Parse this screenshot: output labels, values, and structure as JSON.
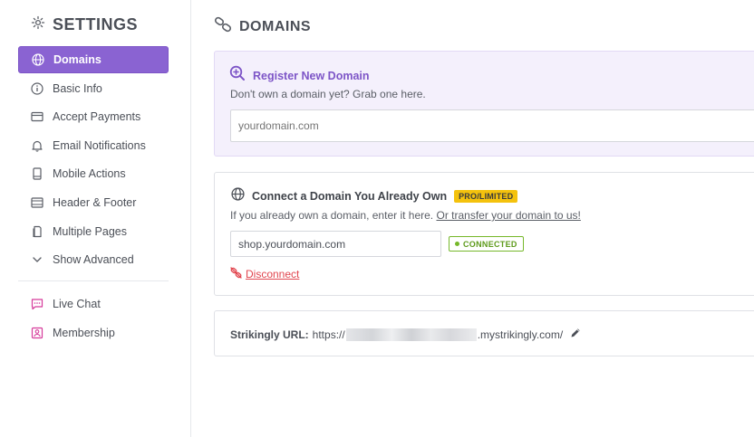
{
  "sidebar": {
    "title": "SETTINGS",
    "items": [
      {
        "label": "Domains",
        "icon": "globe-icon",
        "active": true
      },
      {
        "label": "Basic Info",
        "icon": "info-icon"
      },
      {
        "label": "Accept Payments",
        "icon": "card-icon"
      },
      {
        "label": "Email Notifications",
        "icon": "bell-icon"
      },
      {
        "label": "Mobile Actions",
        "icon": "phone-icon"
      },
      {
        "label": "Header & Footer",
        "icon": "layout-icon"
      },
      {
        "label": "Multiple Pages",
        "icon": "pages-icon"
      },
      {
        "label": "Show Advanced",
        "icon": "chevron-down-icon"
      }
    ],
    "extras": [
      {
        "label": "Live Chat",
        "icon": "chat-icon"
      },
      {
        "label": "Membership",
        "icon": "member-icon"
      }
    ]
  },
  "main": {
    "title": "DOMAINS",
    "register": {
      "title": "Register New Domain",
      "subtitle": "Don't own a domain yet? Grab one here.",
      "placeholder": "yourdomain.com"
    },
    "connect": {
      "title": "Connect a Domain You Already Own",
      "badge": "PRO/LIMITED",
      "subtitle": "If you already own a domain, enter it here.",
      "transfer_link": "Or transfer your domain to us!",
      "value": "shop.yourdomain.com",
      "status": "CONNECTED",
      "disconnect": "Disconnect"
    },
    "url": {
      "label": "Strikingly URL:",
      "prefix": "https://",
      "suffix": ".mystrikingly.com/"
    }
  },
  "colors": {
    "accent": "#8a63d2",
    "connected": "#76b82a",
    "danger": "#e1464f",
    "badge": "#f4c20d"
  }
}
